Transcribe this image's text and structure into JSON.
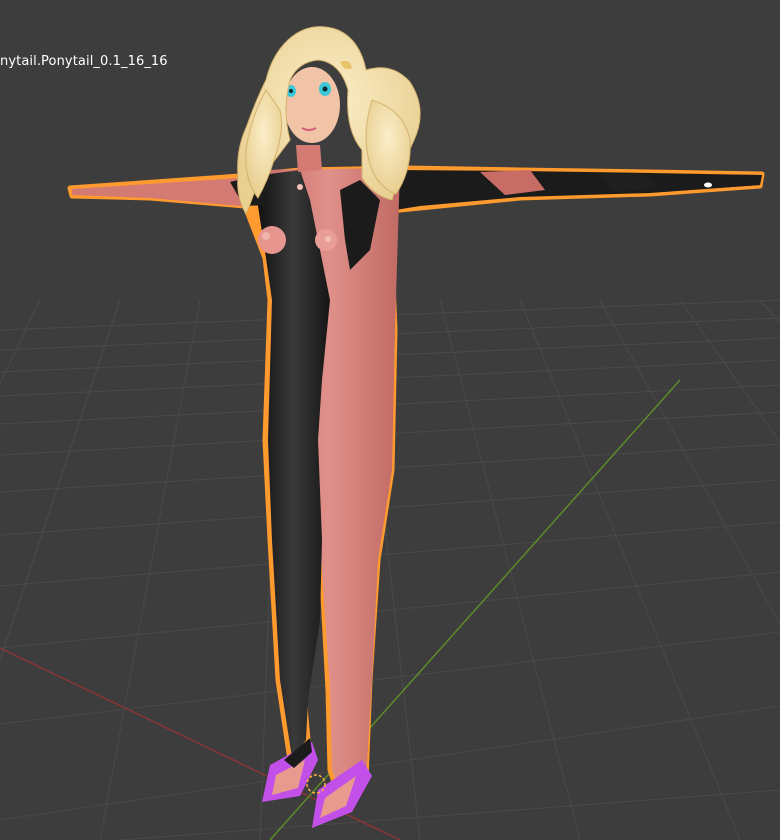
{
  "viewport": {
    "object_name": "nytail.Ponytail_0.1_16_16",
    "background": "#3d3d3d",
    "grid_color": "#4a4a4a",
    "axis_x_color": "#8a3535",
    "axis_y_color": "#5e8a2a",
    "selection_outline_color": "#ff9a2e",
    "object_name_color": "#ffffff"
  },
  "model": {
    "hair_color": "#f2dca3",
    "skin_color": "#d37b72",
    "suit_color": "#1b1b1b",
    "shoe_color": "#c14fe8",
    "eye_color": "#3bc7d6"
  }
}
